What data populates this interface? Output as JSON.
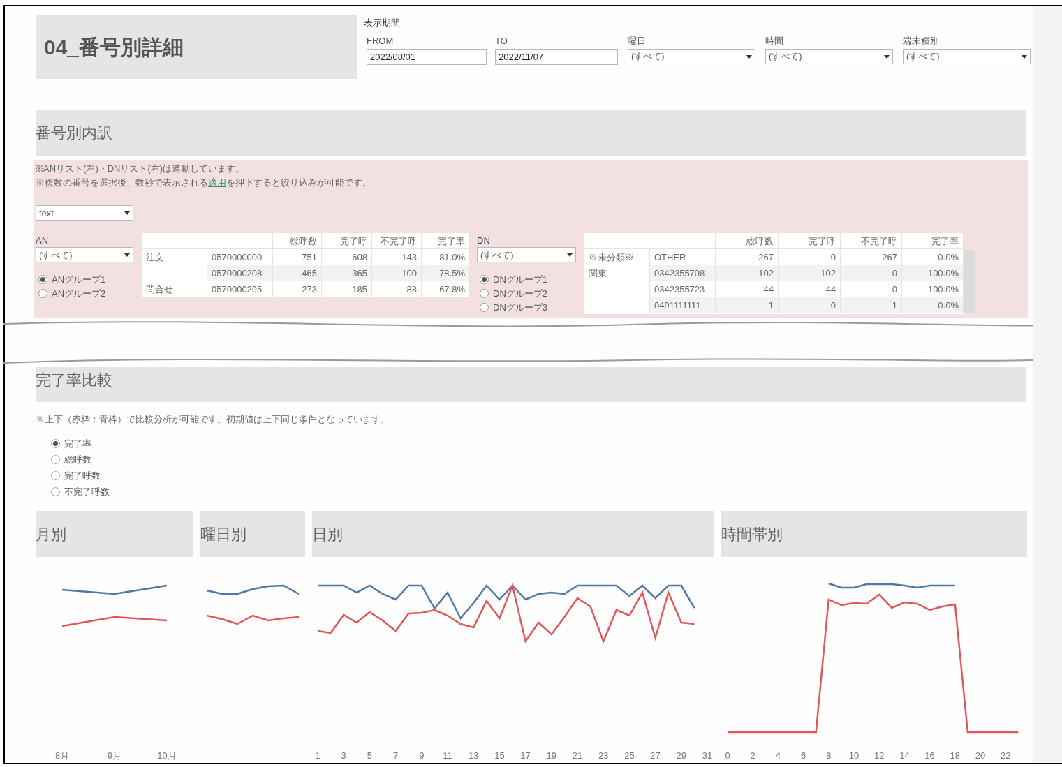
{
  "title": "04_番号別詳細",
  "period": {
    "label": "表示期間",
    "from": {
      "label": "FROM",
      "value": "2022/08/01"
    },
    "to": {
      "label": "TO",
      "value": "2022/11/07"
    }
  },
  "filters": [
    {
      "label": "曜日",
      "value": "(すべて)"
    },
    {
      "label": "時間",
      "value": "(すべて)"
    },
    {
      "label": "端末種別",
      "value": "(すべて)"
    }
  ],
  "breakdown": {
    "heading": "番号別内訳",
    "notes": [
      {
        "text": "※ANリスト(左)・DNリスト(右)は連動しています。"
      },
      {
        "text": "※複数の番号を選択後、数秒で表示される",
        "link": "適用",
        "text_after": "を押下すると絞り込みが可能です。"
      }
    ],
    "mode_select": {
      "value": "text"
    },
    "an": {
      "label": "AN",
      "select": "(すべて)",
      "groups": [
        {
          "label": "ANグループ1",
          "selected": true
        },
        {
          "label": "ANグループ2",
          "selected": false
        }
      ]
    },
    "an_table": {
      "columns": [
        "総呼数",
        "完了呼",
        "不完了呼",
        "完了率"
      ],
      "rows": [
        {
          "group": "注文",
          "number": "0570000000",
          "values": [
            "751",
            "608",
            "143",
            "81.0%"
          ]
        },
        {
          "number": "0570000208",
          "values": [
            "465",
            "365",
            "100",
            "78.5%"
          ]
        },
        {
          "group": "問合せ",
          "number": "0570000295",
          "values": [
            "273",
            "185",
            "88",
            "67.8%"
          ]
        }
      ]
    },
    "dn": {
      "label": "DN",
      "select": "(すべて)",
      "groups": [
        {
          "label": "DNグループ1",
          "selected": true
        },
        {
          "label": "DNグループ2",
          "selected": false
        },
        {
          "label": "DNグループ3",
          "selected": false
        }
      ]
    },
    "dn_table": {
      "columns": [
        "総呼数",
        "完了呼",
        "不完了呼",
        "完了率"
      ],
      "rows": [
        {
          "group": "※未分類※",
          "number": "OTHER",
          "values": [
            "267",
            "0",
            "267",
            "0.0%"
          ]
        },
        {
          "group": "関東",
          "number": "0342355708",
          "values": [
            "102",
            "102",
            "0",
            "100.0%"
          ]
        },
        {
          "number": "0342355723",
          "values": [
            "44",
            "44",
            "0",
            "100.0%"
          ]
        },
        {
          "number": "0491111111",
          "values": [
            "1",
            "0",
            "1",
            "0.0%"
          ]
        }
      ]
    }
  },
  "comparison": {
    "heading": "完了率比較",
    "note": "※上下（赤枠：青枠）で比較分析が可能です。初期値は上下同じ条件となっています。",
    "metrics": [
      {
        "label": "完了率",
        "selected": true
      },
      {
        "label": "総呼数",
        "selected": false
      },
      {
        "label": "完了呼数",
        "selected": false
      },
      {
        "label": "不完了呼数",
        "selected": false
      }
    ],
    "charts": [
      {
        "kind": "month",
        "title": "月別",
        "x_labels": [
          "8月",
          "9月",
          "10月"
        ]
      },
      {
        "kind": "weekday",
        "title": "曜日別"
      },
      {
        "kind": "day",
        "title": "日別",
        "x_labels": [
          "1",
          "3",
          "5",
          "7",
          "9",
          "11",
          "13",
          "15",
          "17",
          "19",
          "21",
          "23",
          "25",
          "27",
          "29",
          "31"
        ]
      },
      {
        "kind": "hour",
        "title": "時間帯別",
        "x_labels": [
          "0",
          "2",
          "4",
          "6",
          "8",
          "10",
          "12",
          "14",
          "16",
          "18",
          "20",
          "22"
        ]
      }
    ]
  }
}
